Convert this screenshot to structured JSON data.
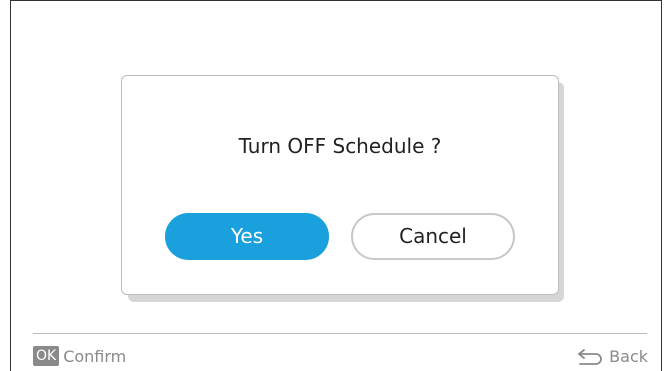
{
  "dialog": {
    "message": "Turn OFF Schedule ?",
    "yes_label": "Yes",
    "cancel_label": "Cancel"
  },
  "footer": {
    "ok_badge": "OK",
    "confirm_label": "Confirm",
    "back_icon": "back-arrow-icon",
    "back_label": "Back"
  },
  "colors": {
    "accent": "#1aa0dc",
    "muted": "#8a8a8a"
  }
}
